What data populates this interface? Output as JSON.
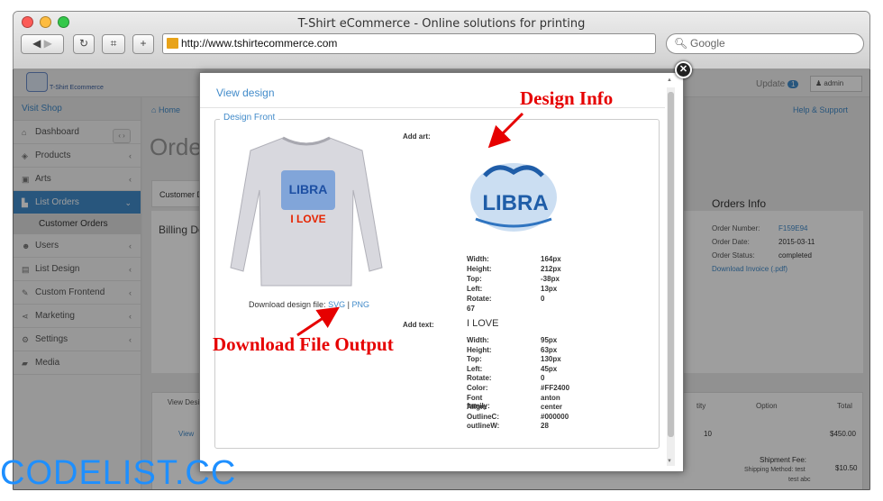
{
  "window": {
    "title": "T-Shirt eCommerce - Online solutions for printing"
  },
  "browser": {
    "address": "http://www.tshirtecommerce.com",
    "search_placeholder": "Google"
  },
  "topbar": {
    "brand": "T-Shirt Ecommerce",
    "update_label": "Update",
    "update_count": "1",
    "user": "admin"
  },
  "sidebar": {
    "visit_shop": "Visit Shop",
    "items": [
      {
        "label": "Dashboard",
        "icon": "home-icon"
      },
      {
        "label": "Products",
        "icon": "tag-icon"
      },
      {
        "label": "Arts",
        "icon": "picture-icon"
      },
      {
        "label": "List Orders",
        "icon": "cart-icon"
      },
      {
        "label": "Users",
        "icon": "users-icon"
      },
      {
        "label": "List Design",
        "icon": "list-icon"
      },
      {
        "label": "Custom Frontend",
        "icon": "brush-icon"
      },
      {
        "label": "Marketing",
        "icon": "share-icon"
      },
      {
        "label": "Settings",
        "icon": "gear-icon"
      },
      {
        "label": "Media",
        "icon": "folder-icon"
      }
    ],
    "sub_item": "Customer Orders"
  },
  "page": {
    "breadcrumb_home": "Home",
    "help": "Help & Support",
    "title_partial": "Order",
    "tab_partial": "Customer D",
    "billing_partial": "Billing De",
    "orders_info": {
      "title": "Orders Info",
      "rows": [
        {
          "label": "Order Number:",
          "value": "F159E94"
        },
        {
          "label": "Order Date:",
          "value": "2015-03-11"
        },
        {
          "label": "Order Status:",
          "value": "completed"
        }
      ],
      "invoice": "Download Invoice (.pdf)"
    },
    "table": {
      "col_view_design": "View Design",
      "col_qty": "tity",
      "col_option": "Option",
      "col_total": "Total",
      "row_view": "View",
      "row_qty": "10",
      "row_total": "$450.00",
      "shipment_label": "Shipment Fee:",
      "shipping_method": "Shipping Method: test",
      "shipping_extra": "test abc",
      "shipment_total": "$10.50"
    }
  },
  "modal": {
    "title": "View design",
    "legend": "Design Front",
    "download_label": "Download design file:",
    "svg_link": "SVG",
    "sep": "|",
    "png_link": "PNG",
    "add_art": "Add art:",
    "add_text": "Add text:",
    "text_value": "I LOVE",
    "shirt_text_1": "LIBRA",
    "shirt_text_2": "I LOVE",
    "art_text": "LIBRA",
    "art_props": [
      {
        "k": "Width:",
        "v": "164px"
      },
      {
        "k": "Height:",
        "v": "212px"
      },
      {
        "k": "Top:",
        "v": "-38px"
      },
      {
        "k": "Left:",
        "v": "13px"
      },
      {
        "k": "Rotate:",
        "v": "0"
      }
    ],
    "art_extra": "67",
    "text_props": [
      {
        "k": "Width:",
        "v": "95px"
      },
      {
        "k": "Height:",
        "v": "63px"
      },
      {
        "k": "Top:",
        "v": "130px"
      },
      {
        "k": "Left:",
        "v": "45px"
      },
      {
        "k": "Rotate:",
        "v": "0"
      },
      {
        "k": "Color:",
        "v": "#FF2400"
      },
      {
        "k": "Font family:",
        "v": "anton"
      },
      {
        "k": "Align:",
        "v": "center"
      },
      {
        "k": "OutlineC:",
        "v": "#000000"
      },
      {
        "k": "outlineW:",
        "v": "28"
      }
    ]
  },
  "annotations": {
    "design_info": "Design Info",
    "download_output": "Download File Output"
  },
  "watermark": "CODELIST.CC",
  "colors": {
    "link": "#428bca",
    "annotation": "#e60000",
    "watermark": "#1e8fff"
  }
}
